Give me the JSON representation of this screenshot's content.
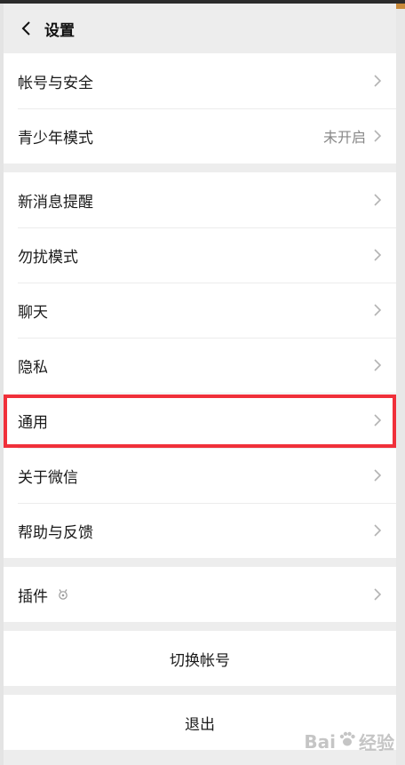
{
  "header": {
    "title": "设置",
    "back_icon": "chevron-left-icon"
  },
  "groups": {
    "account": [
      {
        "label": "帐号与安全"
      },
      {
        "label": "青少年模式",
        "value": "未开启"
      }
    ],
    "main": [
      {
        "label": "新消息提醒"
      },
      {
        "label": "勿扰模式"
      },
      {
        "label": "聊天"
      },
      {
        "label": "隐私"
      },
      {
        "label": "通用",
        "highlighted": true
      },
      {
        "label": "关于微信"
      },
      {
        "label": "帮助与反馈"
      }
    ],
    "plugins": [
      {
        "label": "插件",
        "icon": "plugin-badge-icon"
      }
    ]
  },
  "actions": {
    "switch_account": "切换帐号",
    "logout": "退出"
  },
  "watermark": {
    "text_left": "Bai",
    "text_right": "经验",
    "icon": "baidu-paw-icon"
  },
  "colors": {
    "highlight_border": "#f0303a",
    "page_bg": "#ededed"
  }
}
